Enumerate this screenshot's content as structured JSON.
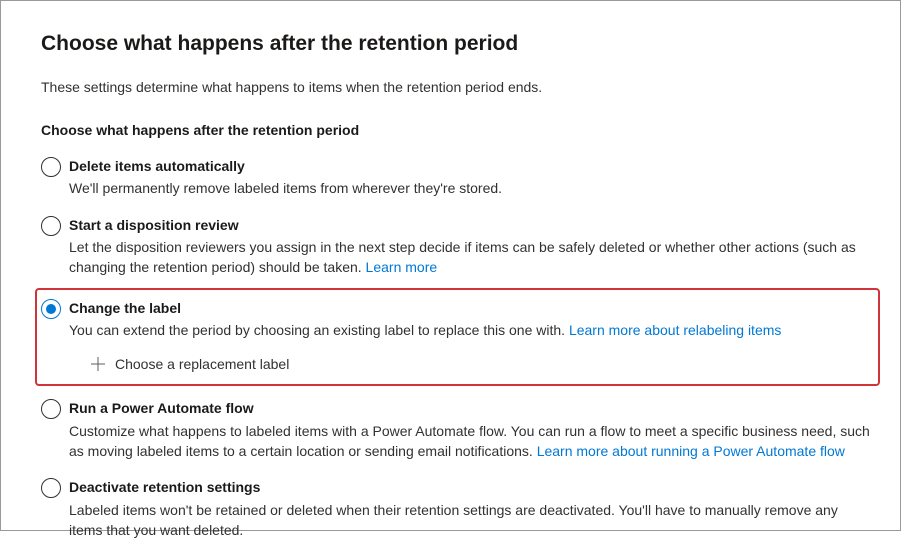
{
  "page": {
    "title": "Choose what happens after the retention period",
    "subtitle": "These settings determine what happens to items when the retention period ends.",
    "section_label": "Choose what happens after the retention period"
  },
  "options": {
    "delete": {
      "title": "Delete items automatically",
      "desc": "We'll permanently remove labeled items from wherever they're stored."
    },
    "disposition": {
      "title": "Start a disposition review",
      "desc_before": "Let the disposition reviewers you assign in the next step decide if items can be safely deleted or whether other actions (such as changing the retention period) should be taken. ",
      "link": "Learn more"
    },
    "change_label": {
      "title": "Change the label",
      "desc_before": "You can extend the period by choosing an existing label to replace this one with. ",
      "link": "Learn more about relabeling items",
      "choose_replacement": "Choose a replacement label"
    },
    "power_automate": {
      "title": "Run a Power Automate flow",
      "desc_before": "Customize what happens to labeled items with a Power Automate flow. You can run a flow to meet a specific business need, such as moving labeled items to a certain location or sending email notifications. ",
      "link": "Learn more about running a Power Automate flow"
    },
    "deactivate": {
      "title": "Deactivate retention settings",
      "desc": "Labeled items won't be retained or deleted when their retention settings are deactivated. You'll have to manually remove any items that you want deleted."
    }
  }
}
